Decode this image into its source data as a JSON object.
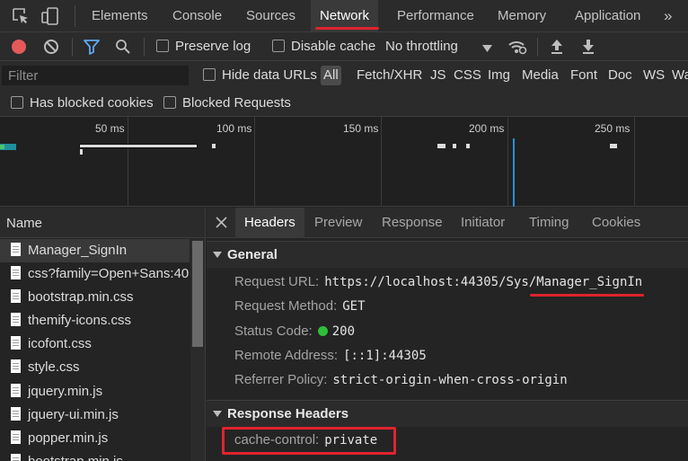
{
  "devtools_tabs": [
    {
      "label": "Elements"
    },
    {
      "label": "Console"
    },
    {
      "label": "Sources"
    },
    {
      "label": "Network"
    },
    {
      "label": "Performance"
    },
    {
      "label": "Memory"
    },
    {
      "label": "Application"
    }
  ],
  "more_tabs_glyph": "»",
  "toolbar": {
    "preserve_log": "Preserve log",
    "disable_cache": "Disable cache",
    "throttling": "No throttling"
  },
  "filter": {
    "placeholder": "Filter",
    "hide_data_urls": "Hide data URLs",
    "types": [
      "All",
      "Fetch/XHR",
      "JS",
      "CSS",
      "Img",
      "Media",
      "Font",
      "Doc",
      "WS",
      "Wa"
    ]
  },
  "blocked": {
    "has_blocked_cookies": "Has blocked cookies",
    "blocked_requests": "Blocked Requests"
  },
  "overview_ticks": [
    "50 ms",
    "100 ms",
    "150 ms",
    "200 ms",
    "250 ms"
  ],
  "list": {
    "header": "Name",
    "items": [
      "Manager_SignIn",
      "css?family=Open+Sans:40...",
      "bootstrap.min.css",
      "themify-icons.css",
      "icofont.css",
      "style.css",
      "jquery.min.js",
      "jquery-ui.min.js",
      "popper.min.js",
      "bootstrap.min.js"
    ]
  },
  "detail_tabs": [
    "Headers",
    "Preview",
    "Response",
    "Initiator",
    "Timing",
    "Cookies"
  ],
  "general": {
    "title": "General",
    "request_url_label": "Request URL:",
    "request_url": "https://localhost:44305/Sys/Manager_SignIn",
    "request_method_label": "Request Method:",
    "request_method": "GET",
    "status_code_label": "Status Code:",
    "status_code": "200",
    "remote_address_label": "Remote Address:",
    "remote_address": "[::1]:44305",
    "referrer_policy_label": "Referrer Policy:",
    "referrer_policy": "strict-origin-when-cross-origin"
  },
  "response_headers": {
    "title": "Response Headers",
    "cache_control_label": "cache-control:",
    "cache_control": "private"
  },
  "colors": {
    "accent_red": "#e0232d",
    "record_red": "#e45a5a",
    "filter_blue": "#5fa8f5",
    "status_green": "#2fbf3a"
  },
  "icons": [
    "inspect-element-icon",
    "device-toolbar-icon",
    "record-icon",
    "clear-icon",
    "filter-icon",
    "search-icon",
    "dropdown-caret-icon",
    "network-conditions-icon",
    "import-icon",
    "export-icon",
    "close-icon",
    "file-icon"
  ]
}
